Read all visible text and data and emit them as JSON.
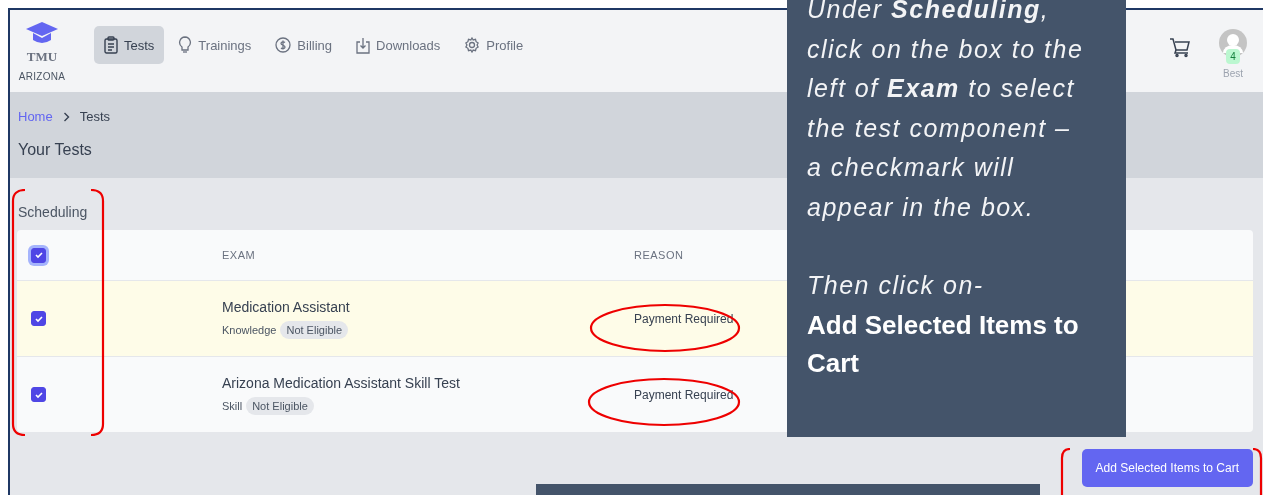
{
  "logo": {
    "title": "TMU",
    "subtitle": "ARIZONA"
  },
  "nav": [
    {
      "label": "Tests",
      "selected": true
    },
    {
      "label": "Trainings",
      "selected": false
    },
    {
      "label": "Billing",
      "selected": false
    },
    {
      "label": "Downloads",
      "selected": false
    },
    {
      "label": "Profile",
      "selected": false
    }
  ],
  "user": {
    "badge": "4",
    "name": "Best"
  },
  "breadcrumb": [
    "Home",
    "Tests"
  ],
  "page_title": "Your Tests",
  "section": "Scheduling",
  "table": {
    "select_all": {
      "checked": true
    },
    "columns": [
      "EXAM",
      "REASON"
    ],
    "rows": [
      {
        "checked": true,
        "highlighted": true,
        "exam": "Medication Assistant",
        "type": "Knowledge",
        "status": "Not Eligible",
        "reason": "Payment Required"
      },
      {
        "checked": true,
        "highlighted": false,
        "exam": "Arizona Medication Assistant Skill Test",
        "type": "Skill",
        "status": "Not Eligible",
        "reason": "Payment Required"
      }
    ]
  },
  "button": "Add Selected Items to Cart",
  "callout": {
    "paragraphs": [
      "*Under* **Scheduling**, *click on the box to the left of* **Exam** *to select the test component – a checkmark will appear in the box.*",
      "*Then click on-*"
    ],
    "action": "Add Selected Items to Cart"
  }
}
